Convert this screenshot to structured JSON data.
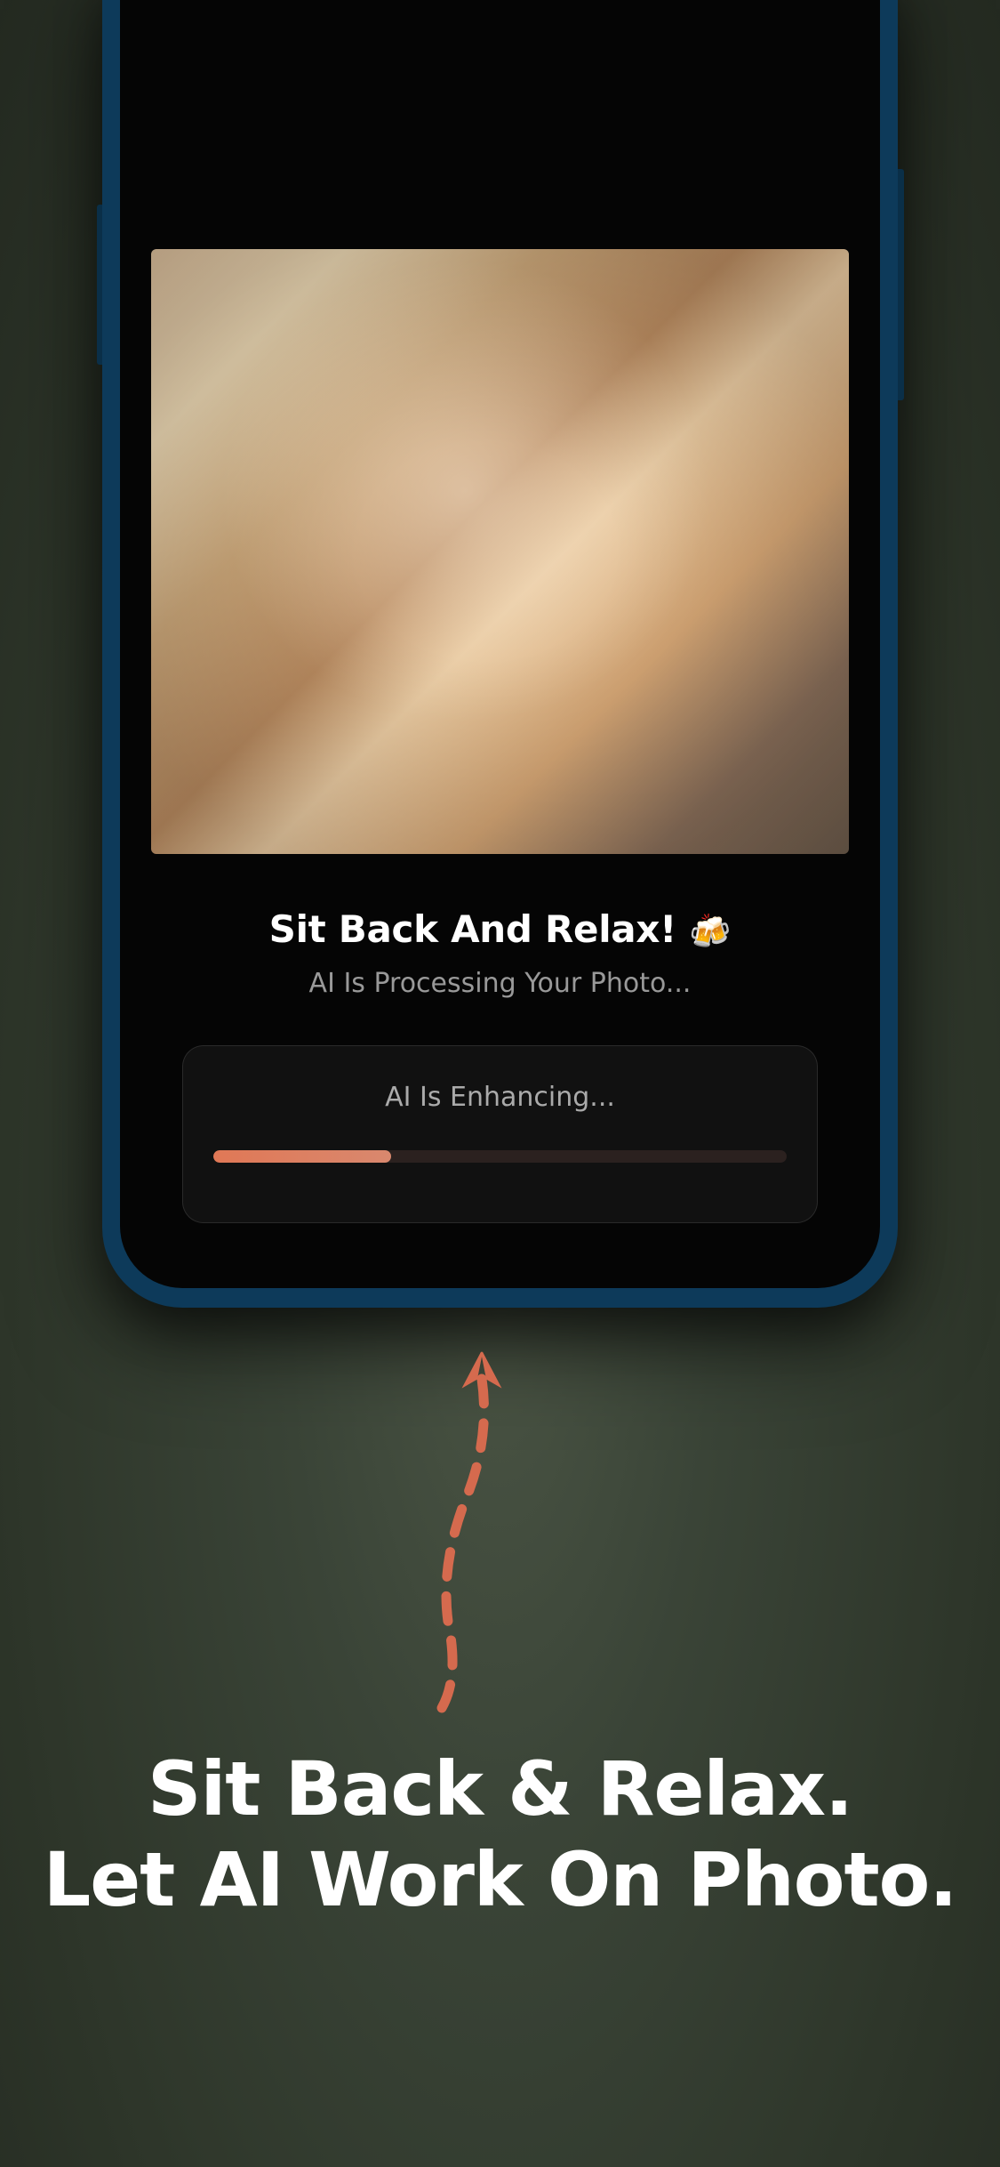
{
  "app": {
    "title_text": "Sit Back And Relax!",
    "title_emoji": "🍻",
    "subtitle": "AI Is Processing Your Photo...",
    "progress": {
      "label": "AI Is Enhancing...",
      "percent": 31
    }
  },
  "marketing": {
    "headline_line1": "Sit Back & Relax.",
    "headline_line2": "Let AI Work On Photo."
  },
  "colors": {
    "accent": "#e07856",
    "phone_frame": "#0d3a5a",
    "background": "#3a4437"
  }
}
